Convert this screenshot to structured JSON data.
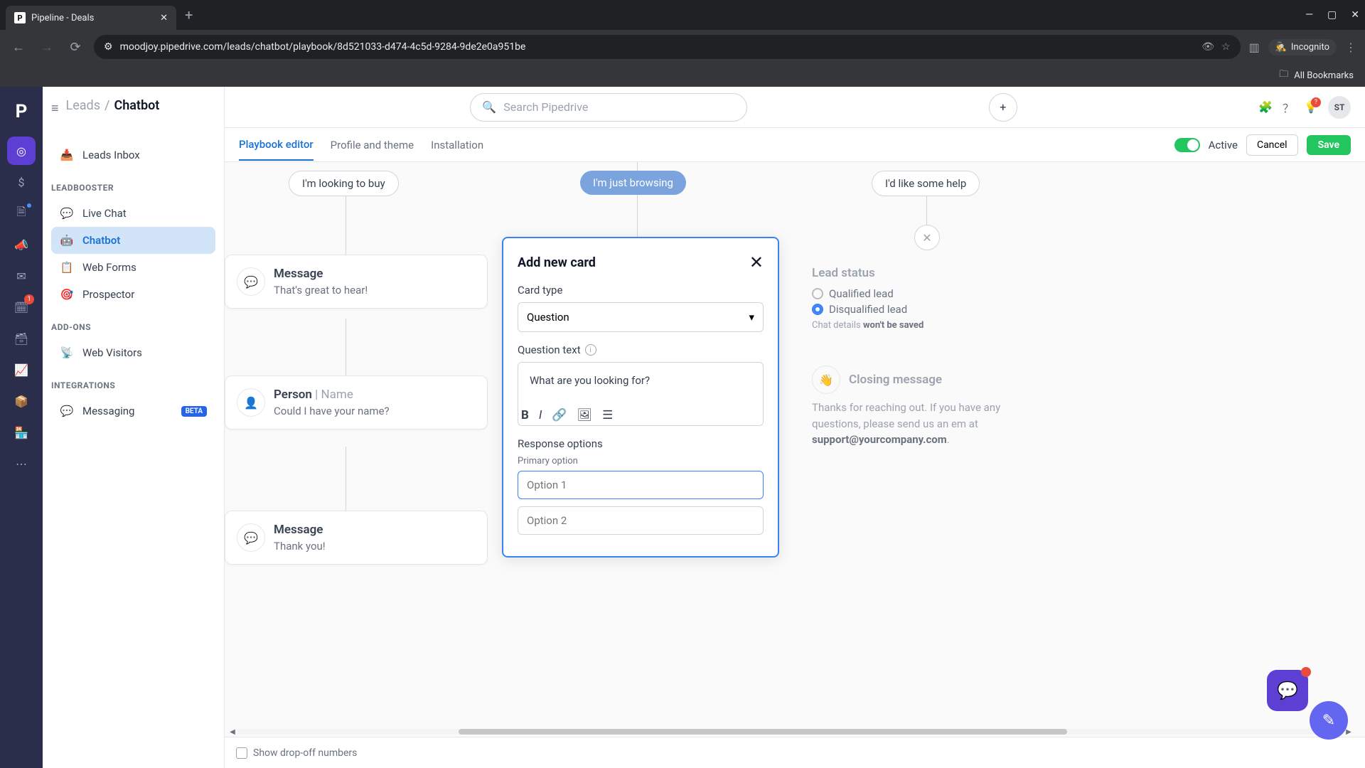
{
  "browser": {
    "tab_title": "Pipeline - Deals",
    "url": "moodjoy.pipedrive.com/leads/chatbot/playbook/8d521033-d474-4c5d-9284-9de2e0a951be",
    "incognito": "Incognito",
    "all_bookmarks": "All Bookmarks"
  },
  "header": {
    "breadcrumb_parent": "Leads",
    "breadcrumb_current": "Chatbot",
    "search_placeholder": "Search Pipedrive",
    "avatar": "ST",
    "bulb_badge": "?"
  },
  "rail_badge": "1",
  "sidebar": {
    "inbox": "Leads Inbox",
    "group1": "LEADBOOSTER",
    "live_chat": "Live Chat",
    "chatbot": "Chatbot",
    "web_forms": "Web Forms",
    "prospector": "Prospector",
    "group2": "ADD-ONS",
    "web_visitors": "Web Visitors",
    "group3": "INTEGRATIONS",
    "messaging": "Messaging",
    "beta": "BETA"
  },
  "subnav": {
    "tab1": "Playbook editor",
    "tab2": "Profile and theme",
    "tab3": "Installation",
    "active_label": "Active",
    "cancel": "Cancel",
    "save": "Save"
  },
  "chips": {
    "buy": "I'm looking to buy",
    "browse": "I'm just browsing",
    "help": "I'd like some help"
  },
  "cards": {
    "msg1_title": "Message",
    "msg1_text": "That's great to hear!",
    "person_title": "Person",
    "person_name": "Name",
    "person_text": "Could I have your name?",
    "msg2_title": "Message",
    "msg2_text": "Thank you!",
    "lead_title": "Lead status",
    "lead_q": "Qualified lead",
    "lead_dq": "Disqualified lead",
    "lead_hint_pre": "Chat details ",
    "lead_hint_b": "won't be saved",
    "closing_title": "Closing message",
    "closing_text_pre": "Thanks for reaching out. If you have any questions, please send us an em at ",
    "closing_email": "support@yourcompany.com",
    "closing_text_post": "."
  },
  "modal": {
    "title": "Add new card",
    "card_type_label": "Card type",
    "card_type_value": "Question",
    "question_label": "Question text",
    "question_value": "What are you looking for?",
    "resp_label": "Response options",
    "primary_label": "Primary option",
    "opt1_placeholder": "Option 1",
    "opt2_placeholder": "Option 2"
  },
  "footer": {
    "dropoff": "Show drop-off numbers"
  }
}
